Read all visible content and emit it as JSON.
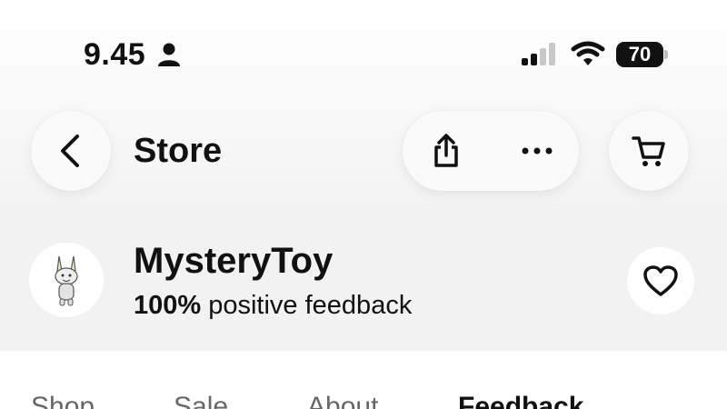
{
  "status_bar": {
    "time": "9.45",
    "battery": "70",
    "icons": [
      "person-icon",
      "signal-icon",
      "wifi-icon",
      "battery-icon"
    ]
  },
  "header": {
    "title": "Store",
    "icons": [
      "back-arrow-icon",
      "share-icon",
      "more-icon",
      "cart-icon"
    ]
  },
  "store": {
    "name": "MysteryToy",
    "feedback_percent": "100%",
    "feedback_text": "positive feedback",
    "icons": [
      "store-avatar",
      "heart-icon"
    ]
  },
  "tabs": [
    {
      "label": "Shop"
    },
    {
      "label": "Sale"
    },
    {
      "label": "About"
    },
    {
      "label": "Feedback",
      "active": true
    }
  ],
  "colors": {
    "text": "#111111",
    "muted_tab": "#666666",
    "store_band": "#f2f2f2"
  }
}
